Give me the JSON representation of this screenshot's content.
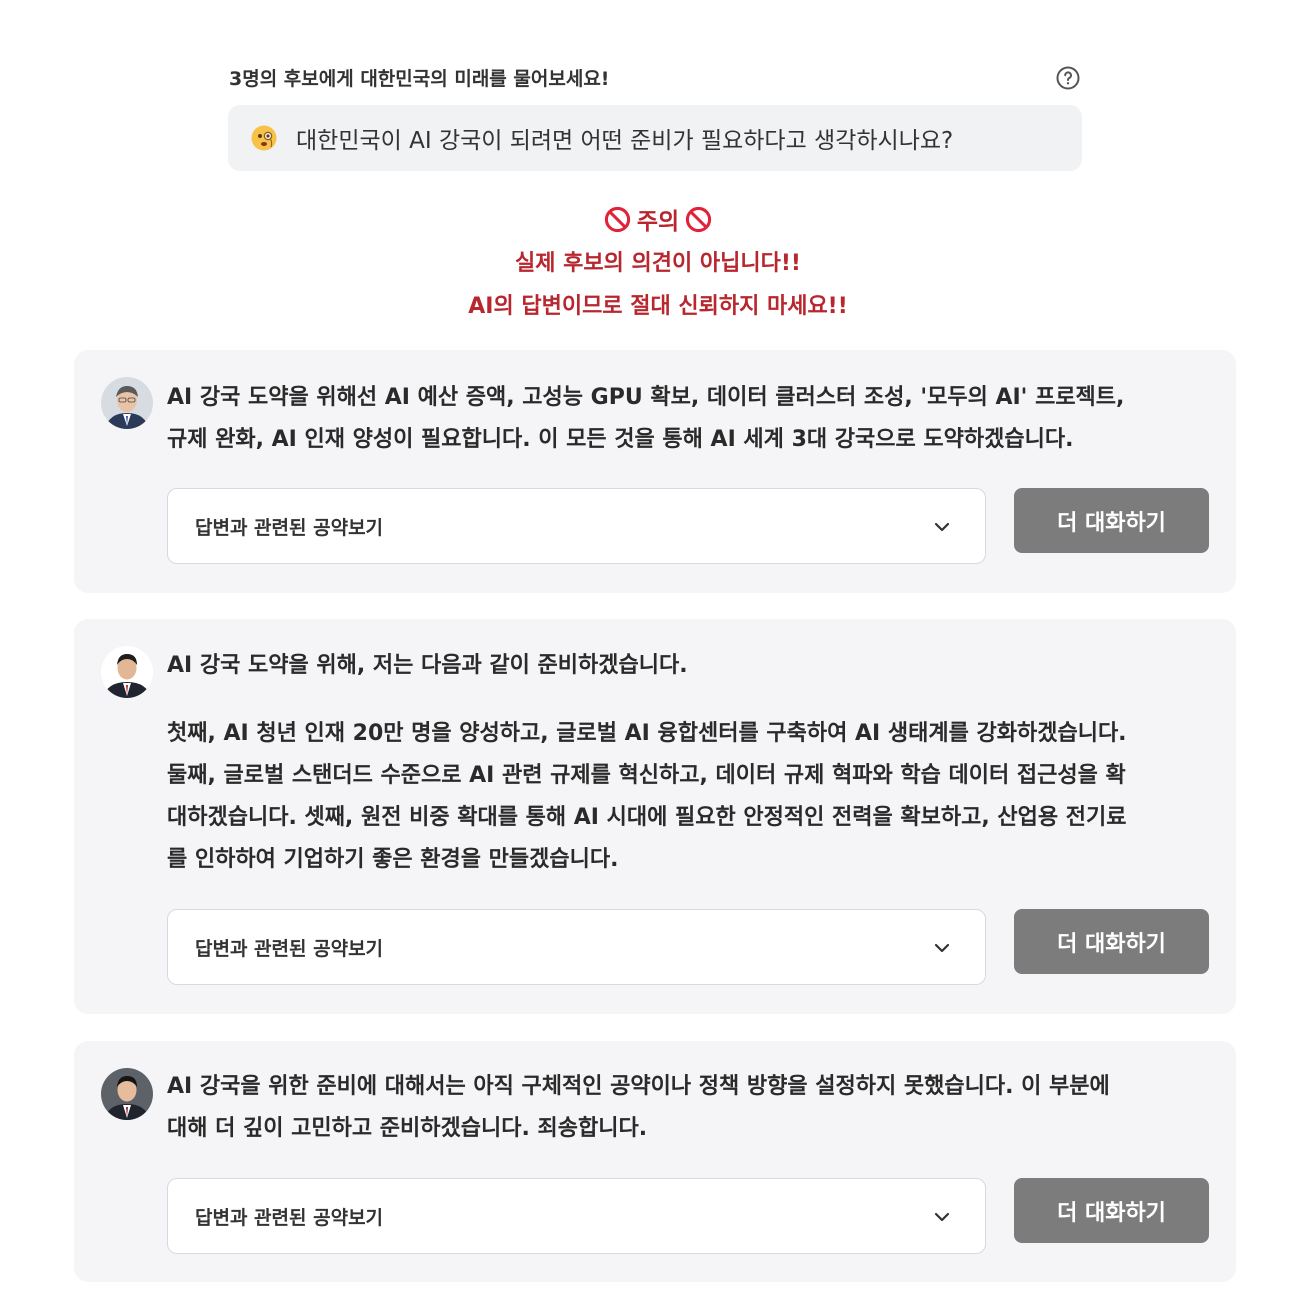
{
  "header": {
    "prompt_label": "3명의 후보에게 대한민국의 미래를 물어보세요!",
    "help_icon": "question-circle-icon",
    "question_emoji": "face-with-monocle-icon",
    "question": "대한민국이 AI 강국이 되려면 어떤 준비가 필요하다고 생각하시나요?"
  },
  "warning": {
    "title": "주의",
    "icon": "prohibited-icon",
    "line1": "실제 후보의 의견이 아닙니다!!",
    "line2": "AI의 답변이므로 절대 신뢰하지 마세요!!",
    "color": "#b8262e"
  },
  "cards": [
    {
      "answer": "AI 강국 도약을 위해선 AI 예산 증액, 고성능 GPU 확보, 데이터 클러스터 조성, '모두의 AI' 프로젝트,\n규제 완화, AI 인재 양성이 필요합니다. 이 모든 것을 통해 AI 세계 3대 강국으로 도약하겠습니다.",
      "select_label": "답변과 관련된 공약보기",
      "button_label": "더 대화하기"
    },
    {
      "answer_intro": "AI 강국 도약을 위해, 저는 다음과 같이 준비하겠습니다.",
      "answer": "첫째, AI 청년 인재 20만 명을 양성하고, 글로벌 AI 융합센터를 구축하여 AI 생태계를 강화하겠습니다.\n둘째, 글로벌 스탠더드 수준으로 AI 관련 규제를 혁신하고, 데이터 규제 혁파와 학습 데이터 접근성을 확\n대하겠습니다. 셋째, 원전 비중 확대를 통해 AI 시대에 필요한 안정적인 전력을 확보하고, 산업용 전기료\n를 인하하여 기업하기 좋은 환경을 만들겠습니다.",
      "select_label": "답변과 관련된 공약보기",
      "button_label": "더 대화하기"
    },
    {
      "answer": "AI 강국을 위한 준비에 대해서는 아직 구체적인 공약이나 정책 방향을 설정하지 못했습니다. 이 부분에\n대해 더 깊이 고민하고 준비하겠습니다. 죄송합니다.",
      "select_label": "답변과 관련된 공약보기",
      "button_label": "더 대화하기"
    }
  ],
  "colors": {
    "card_bg": "#f5f5f7",
    "button_bg": "#7c7c7c",
    "question_bg": "#f1f2f4"
  }
}
